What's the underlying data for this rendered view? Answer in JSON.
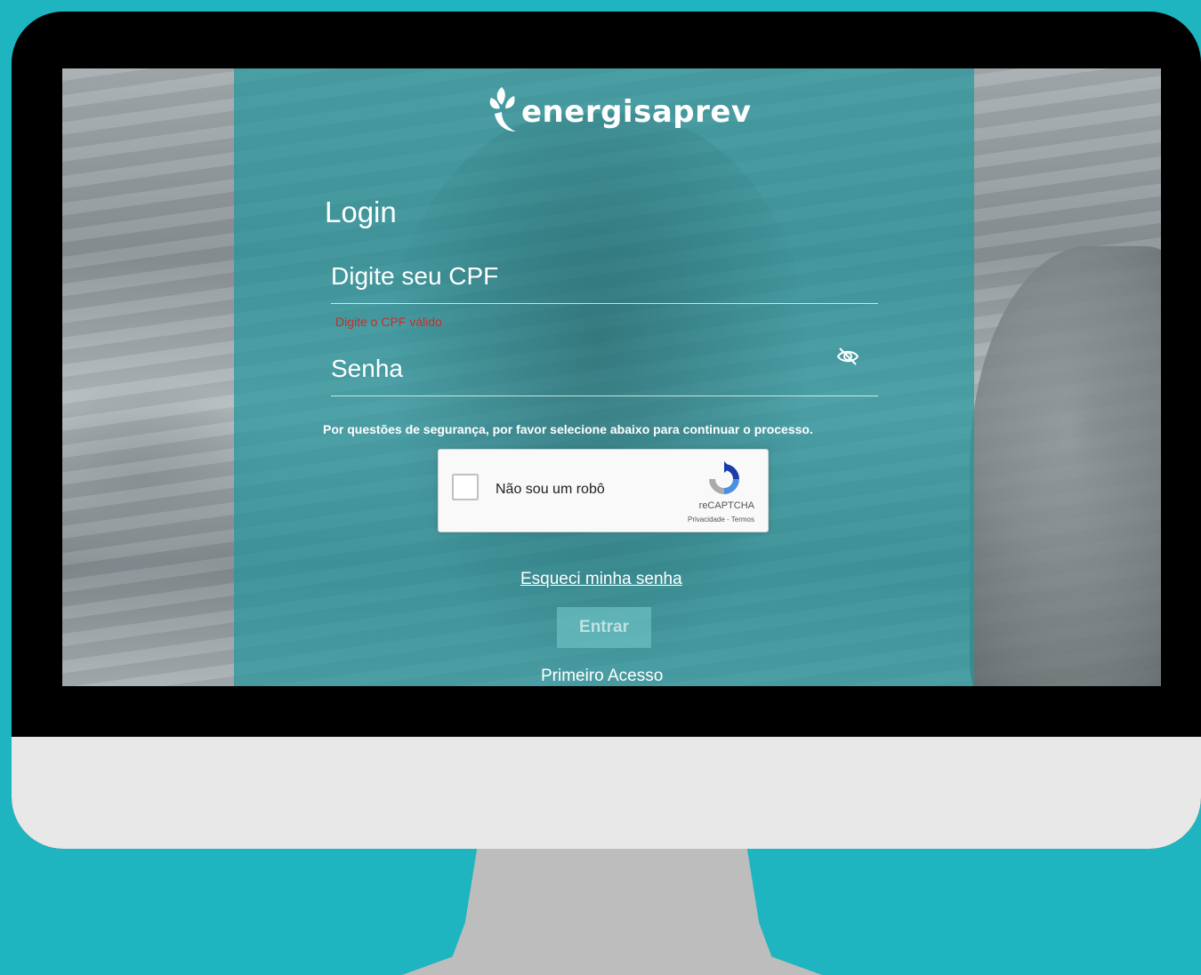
{
  "brand": {
    "name": "energisaprev"
  },
  "login": {
    "title": "Login",
    "cpf_placeholder": "Digite seu CPF",
    "cpf_error": "Digite o CPF válido",
    "password_placeholder": "Senha",
    "password_toggle_icon": "eye-off-icon"
  },
  "security": {
    "notice": "Por questões de segurança, por favor selecione abaixo para continuar o processo."
  },
  "recaptcha": {
    "label": "Não sou um robô",
    "brand": "reCAPTCHA",
    "links": "Privacidade - Termos"
  },
  "actions": {
    "forgot_password": "Esqueci minha senha",
    "submit": "Entrar",
    "first_access": "Primeiro Acesso"
  },
  "colors": {
    "backdrop": "#1fb5c0",
    "panel": "#24969c",
    "error": "#c4302b"
  }
}
